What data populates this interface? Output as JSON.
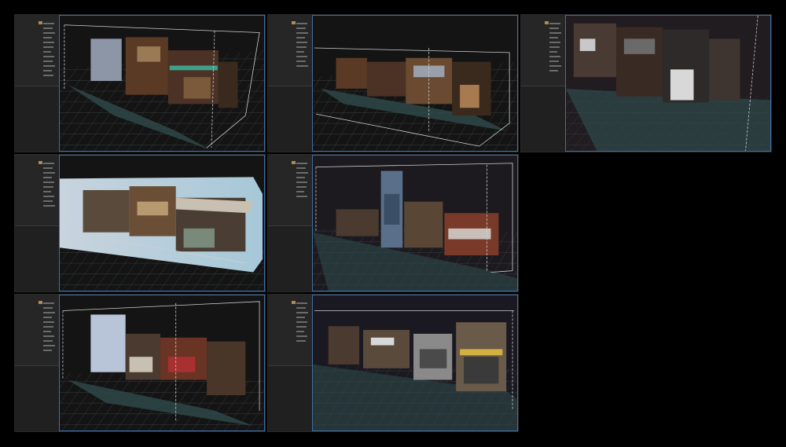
{
  "colors": {
    "background": "#000000",
    "panel": "#1b1b1b",
    "viewport_border": "#3e6fa8",
    "grid": "#3a3f42",
    "ground": "#2f4a4a",
    "bbox": "#cfcfcf"
  },
  "icons": {
    "viewport": "3d-viewport-icon",
    "bounding_box": "bounding-box-icon",
    "point_cloud": "point-cloud-icon"
  },
  "panels": [
    {
      "id": "panel-1"
    },
    {
      "id": "panel-2"
    },
    {
      "id": "panel-3"
    },
    {
      "id": "panel-4"
    },
    {
      "id": "panel-5"
    },
    {
      "id": "panel-6"
    },
    {
      "id": "panel-7"
    }
  ]
}
